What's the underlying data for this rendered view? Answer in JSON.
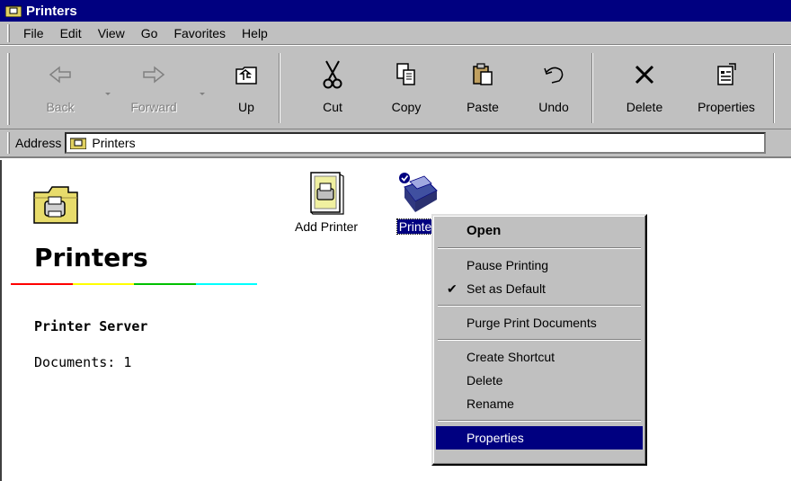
{
  "window": {
    "title": "Printers"
  },
  "menubar": {
    "items": [
      "File",
      "Edit",
      "View",
      "Go",
      "Favorites",
      "Help"
    ]
  },
  "toolbar": {
    "buttons": [
      {
        "label": "Back",
        "icon": "back-arrow-icon",
        "enabled": false
      },
      {
        "label": "Forward",
        "icon": "forward-arrow-icon",
        "enabled": false
      },
      {
        "label": "Up",
        "icon": "up-folder-icon",
        "enabled": true
      },
      {
        "label": "Cut",
        "icon": "scissors-icon",
        "enabled": true
      },
      {
        "label": "Copy",
        "icon": "copy-icon",
        "enabled": true
      },
      {
        "label": "Paste",
        "icon": "paste-icon",
        "enabled": true
      },
      {
        "label": "Undo",
        "icon": "undo-icon",
        "enabled": true
      },
      {
        "label": "Delete",
        "icon": "delete-x-icon",
        "enabled": true
      },
      {
        "label": "Properties",
        "icon": "properties-icon",
        "enabled": true
      }
    ]
  },
  "address": {
    "label": "Address",
    "value": "Printers",
    "icon": "printers-folder-icon"
  },
  "left_panel": {
    "title": "Printers",
    "server": "Printer Server",
    "documents": "Documents: 1",
    "rainbow_colors": [
      "#ff0000",
      "#ffff00",
      "#00c000",
      "#00ffff"
    ]
  },
  "items": [
    {
      "label": "Add Printer",
      "icon": "add-printer-icon",
      "selected": false
    },
    {
      "label": "Printe",
      "icon": "printer-icon",
      "selected": true
    }
  ],
  "context_menu": {
    "items": [
      {
        "label": "Open",
        "bold": true
      },
      {
        "sep": true
      },
      {
        "label": "Pause Printing"
      },
      {
        "label": "Set as Default",
        "checked": true
      },
      {
        "sep": true
      },
      {
        "label": "Purge Print Documents"
      },
      {
        "sep": true
      },
      {
        "label": "Create Shortcut"
      },
      {
        "label": "Delete"
      },
      {
        "label": "Rename"
      },
      {
        "sep": true
      },
      {
        "label": "Properties",
        "highlighted": true
      }
    ]
  },
  "colors": {
    "titlebar": "#000080",
    "chrome": "#c0c0c0",
    "highlight": "#000080"
  }
}
